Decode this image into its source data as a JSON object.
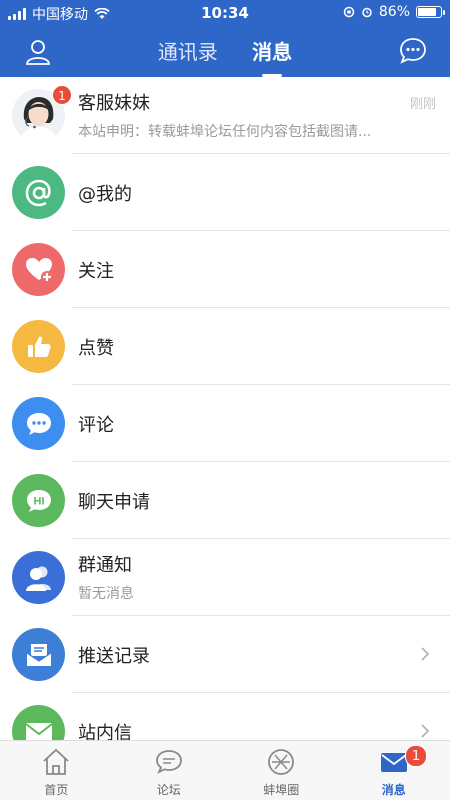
{
  "status_bar": {
    "carrier": "中国移动",
    "time": "10:34",
    "battery": "86%",
    "battery_level": 0.86
  },
  "nav": {
    "tabs": [
      {
        "label": "通讯录",
        "active": false
      },
      {
        "label": "消息",
        "active": true
      }
    ],
    "left_icon": "user-icon",
    "right_icon": "chat-bubble-icon"
  },
  "list": [
    {
      "title": "客服妹妹",
      "subtitle": "本站申明：转载蚌埠论坛任何内容包括截图请...",
      "time": "刚刚",
      "badge": "1",
      "icon": "customer-service-avatar",
      "color": "#e9eef3"
    },
    {
      "title": "@我的",
      "subtitle": "",
      "icon": "at-icon",
      "color": "#4cb882"
    },
    {
      "title": "关注",
      "subtitle": "",
      "icon": "heart-plus-icon",
      "color": "#ee6a6a"
    },
    {
      "title": "点赞",
      "subtitle": "",
      "icon": "thumbs-up-icon",
      "color": "#f5b942"
    },
    {
      "title": "评论",
      "subtitle": "",
      "icon": "comment-icon",
      "color": "#3d8ef0"
    },
    {
      "title": "聊天申请",
      "subtitle": "",
      "icon": "hi-chat-icon",
      "color": "#5cb85c"
    },
    {
      "title": "群通知",
      "subtitle": "暂无消息",
      "icon": "group-icon",
      "color": "#3a6fd8"
    },
    {
      "title": "推送记录",
      "subtitle": "",
      "icon": "push-record-icon",
      "color": "#3d7fd6",
      "chevron": true
    },
    {
      "title": "站内信",
      "subtitle": "",
      "icon": "mail-icon",
      "color": "#5cb85c",
      "chevron": true
    }
  ],
  "tabbar": {
    "items": [
      {
        "label": "首页",
        "icon": "home-icon",
        "active": false
      },
      {
        "label": "论坛",
        "icon": "forum-icon",
        "active": false
      },
      {
        "label": "蚌埠圈",
        "icon": "circle-icon",
        "active": false
      },
      {
        "label": "消息",
        "icon": "message-icon",
        "active": true,
        "badge": "1"
      }
    ]
  },
  "colors": {
    "header": "#2f67c8",
    "badge": "#e74c3c"
  }
}
